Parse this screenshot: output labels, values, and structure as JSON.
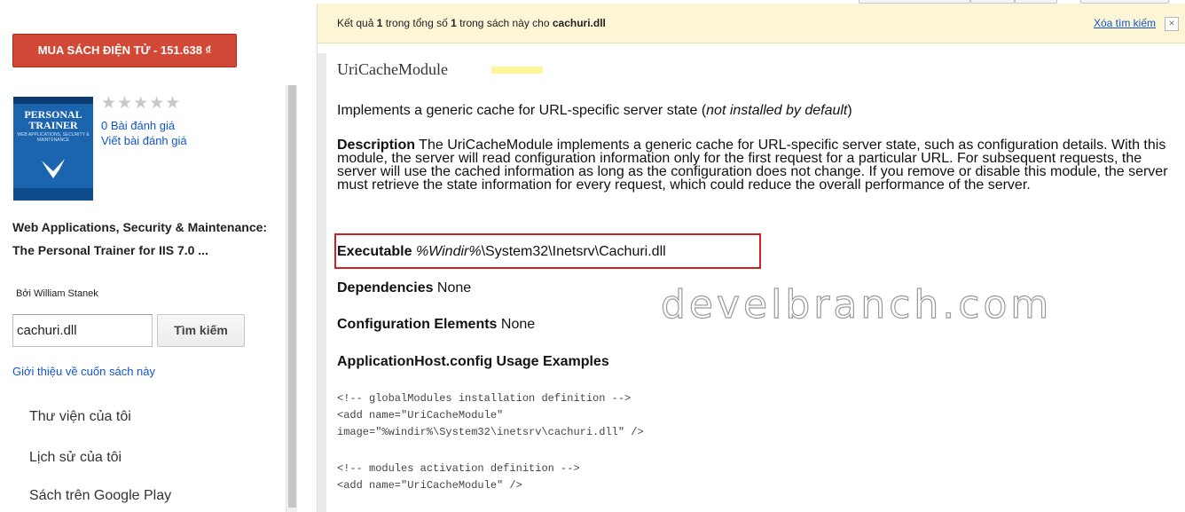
{
  "sidebar": {
    "buy_button": "MUA SÁCH ĐIỆN TỬ - 151.638 ₫",
    "cover": {
      "title_line1": "PERSONAL",
      "title_line2": "TRAINER",
      "subtitle": "WEB APPLICATIONS, SECURITY & MAINTENANCE"
    },
    "rating_stars": "★★★★★",
    "reviews_link": "0 Bài đánh giá",
    "write_review_link": "Viết bài đánh giá",
    "book_title": "Web Applications, Security & Maintenance: The Personal Trainer for IIS 7.0 ...",
    "author": "Bởi William Stanek",
    "search": {
      "value": "cachuri.dll",
      "button": "Tìm kiếm"
    },
    "about_link": "Giới thiệu về cuốn sách này",
    "nav": [
      "Thư viện của tôi",
      "Lịch sử của tôi",
      "Sách trên Google Play"
    ]
  },
  "result_bar": {
    "prefix": "Kết quả ",
    "count": "1",
    "middle": " trong tổng số ",
    "total": "1",
    "suffix": " trong sách này cho ",
    "query": "cachuri.dll",
    "clear_link": "Xóa tìm kiếm",
    "close": "×"
  },
  "content": {
    "module_heading": "UriCacheModule",
    "summary_text": "Implements a generic cache for URL-specific server state (",
    "summary_italic": "not installed by default",
    "summary_end": ")",
    "description_label": "Description",
    "description_text": " The UriCacheModule implements a generic cache for URL-specific server state, such as configuration details. With this module, the server will read configuration information only for the first request for a particular URL. For subsequent requests, the server will use the cached information as long as the configuration does not change. If you remove or disable this module, the server must retrieve the state information for every request, which could reduce the overall performance of the server.",
    "executable_label": "Executable",
    "executable_italic": "%Windir%",
    "executable_path": "\\System32\\Inetsrv\\Cachuri.dll",
    "dependencies_label": "Dependencies",
    "dependencies_value": " None",
    "config_label": "Configuration Elements",
    "config_value": " None",
    "usage_heading": "ApplicationHost.config Usage Examples",
    "code_block_1": "<!-- globalModules installation definition -->\n<add name=\"UriCacheModule\"\nimage=\"%windir%\\System32\\inetsrv\\cachuri.dll\" />",
    "code_block_2": "<!-- modules activation definition -->\n<add name=\"UriCacheModule\" />"
  },
  "watermark": "develbranch.com",
  "colors": {
    "buy_button": "#d14836",
    "link": "#1155cc",
    "result_bar": "#fcf6d6",
    "highlight_box": "#d02020"
  }
}
